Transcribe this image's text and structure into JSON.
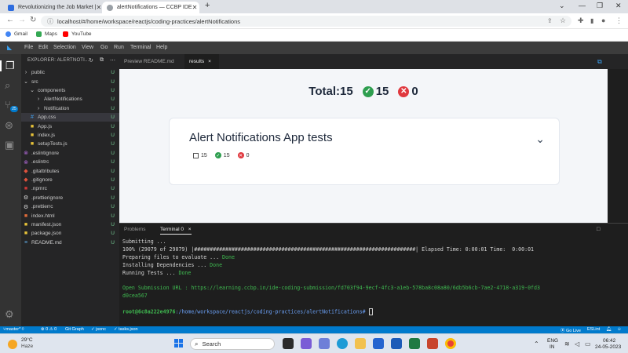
{
  "browser": {
    "tabs": [
      {
        "title": "Revolutionizing the Job Market |",
        "active": false
      },
      {
        "title": "alertNotifications — CCBP IDE",
        "active": true
      }
    ],
    "new_tab": "+",
    "url": "localhost/#/home/workspace/reactjs/coding-practices/alertNotifications",
    "bookmarks": [
      "Gmail",
      "Maps",
      "YouTube"
    ]
  },
  "menu": [
    "File",
    "Edit",
    "Selection",
    "View",
    "Go",
    "Run",
    "Terminal",
    "Help"
  ],
  "explorer": {
    "title": "EXPLORER: ALERTNOTI...",
    "items": [
      {
        "name": "public",
        "icon": "folder-chevron",
        "indent": 1,
        "status": "U"
      },
      {
        "name": "src",
        "icon": "folder-open",
        "indent": 1,
        "status": "U"
      },
      {
        "name": "components",
        "icon": "folder-open",
        "indent": 2,
        "status": "U"
      },
      {
        "name": "AlertNotifications",
        "icon": "folder-chevron",
        "indent": 3,
        "status": "U"
      },
      {
        "name": "Notification",
        "icon": "folder-chevron",
        "indent": 3,
        "status": "U"
      },
      {
        "name": "App.css",
        "icon": "css-file",
        "indent": 2,
        "status": "U",
        "selected": true
      },
      {
        "name": "App.js",
        "icon": "js-file",
        "indent": 2,
        "status": "U"
      },
      {
        "name": "index.js",
        "icon": "js-file",
        "indent": 2,
        "status": "U"
      },
      {
        "name": "setupTests.js",
        "icon": "js-file",
        "indent": 2,
        "status": "U"
      },
      {
        "name": ".eslintignore",
        "icon": "config-file",
        "indent": 1,
        "status": "U"
      },
      {
        "name": ".eslintrc",
        "icon": "config-file",
        "indent": 1,
        "status": "U"
      },
      {
        "name": ".gitattributes",
        "icon": "git-file",
        "indent": 1,
        "status": "U"
      },
      {
        "name": ".gitignore",
        "icon": "git-file",
        "indent": 1,
        "status": "U"
      },
      {
        "name": ".npmrc",
        "icon": "npm-file",
        "indent": 1,
        "status": "U"
      },
      {
        "name": ".prettierignore",
        "icon": "gear-file",
        "indent": 1,
        "status": "U"
      },
      {
        "name": ".prettierrc",
        "icon": "gear-file",
        "indent": 1,
        "status": "U"
      },
      {
        "name": "index.html",
        "icon": "html-file",
        "indent": 1,
        "status": "U"
      },
      {
        "name": "manifest.json",
        "icon": "json-file",
        "indent": 1,
        "status": "U"
      },
      {
        "name": "package.json",
        "icon": "json-file",
        "indent": 1,
        "status": "U"
      },
      {
        "name": "README.md",
        "icon": "md-file",
        "indent": 1,
        "status": "U"
      }
    ]
  },
  "editor_tabs": [
    {
      "label": "Preview README.md",
      "active": false
    },
    {
      "label": "results",
      "active": true,
      "close": "×"
    }
  ],
  "results": {
    "total_label": "Total:15",
    "passed": "15",
    "failed": "0",
    "card_title": "Alert Notifications App tests",
    "card_total": "15",
    "card_passed": "15",
    "card_failed": "0"
  },
  "panel": {
    "tabs": [
      {
        "label": "Problems",
        "active": false
      },
      {
        "label": "Terminal 0",
        "active": true,
        "close": "×"
      }
    ],
    "lines": [
      "Submitting ...",
      "100% (29079 of 29079) |#######################################################################| Elapsed Time: 0:00:01 Time:  0:00:01",
      "Preparing files to evaluate ... ",
      "Installing Dependencies ... ",
      "Running Tests ... "
    ],
    "done": "Done",
    "submission_line1": "Open Submission URL : https://learning.ccbp.in/ide-coding-submission/fd703f94-9ecf-4fc3-a1eb-578ba8c08a80/6db5b6cb-7ae2-4718-a319-0fd3",
    "submission_line2": "d0cea567",
    "prompt_user": "root@6c8a222e4976",
    "prompt_path": ":/home/workspace/reactjs/coding-practices/alertNotifications#"
  },
  "statusbar": {
    "branch": "master*",
    "counts": "⊗ 0 ⚠ 0",
    "git_graph": "Git Graph",
    "jsonc": "✓ jsonc",
    "tasks": "✓ tasks.json",
    "go_live": "Go Live",
    "eslint": "ESLint"
  },
  "taskbar": {
    "weather_temp": "29°C",
    "weather_desc": "Haze",
    "search": "Search",
    "lang": "ENG",
    "lang2": "IN",
    "time": "06:42",
    "date": "24-05-2023"
  },
  "colors": {
    "accent": "#007acc",
    "pass": "#2e9e4f",
    "fail": "#e0383e"
  }
}
